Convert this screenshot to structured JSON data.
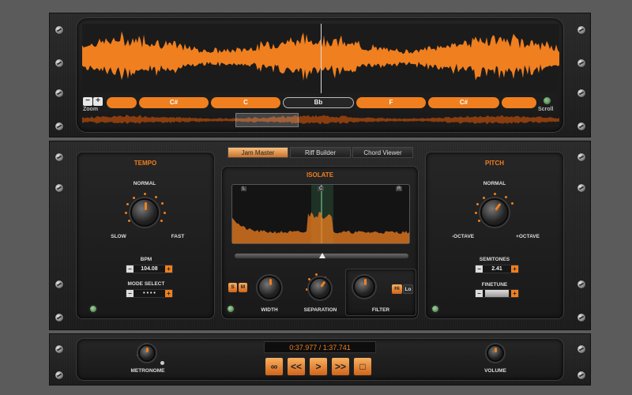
{
  "waveform": {
    "zoom_label": "Zoom",
    "scroll_label": "Scroll",
    "zoom_minus": "−",
    "zoom_plus": "+"
  },
  "chords": [
    "",
    "C#",
    "C",
    "Bb",
    "F",
    "C#",
    ""
  ],
  "tabs": [
    "Jam Master",
    "Riff Builder",
    "Chord Viewer"
  ],
  "tempo": {
    "title": "TEMPO",
    "normal": "NORMAL",
    "slow": "SLOW",
    "fast": "FAST",
    "bpm_label": "BPM",
    "bpm_value": "104.08",
    "mode_label": "MODE SELECT",
    "mode_value": "• • • •"
  },
  "isolate": {
    "title": "ISOLATE",
    "tag_l": "L",
    "tag_c": "C",
    "tag_r": "R",
    "s": "S",
    "m": "M",
    "width": "WIDTH",
    "separation": "SEPARATION",
    "filter": "FILTER",
    "hi": "Hi",
    "lo": "Lo"
  },
  "pitch": {
    "title": "PITCH",
    "normal": "NORMAL",
    "minus_octave": "-OCTAVE",
    "plus_octave": "+OCTAVE",
    "semitones_label": "SEMITONES",
    "semitones_value": "2.41",
    "finetune_label": "FINETUNE"
  },
  "transport": {
    "time": "0:37.977 / 1:37.741",
    "metronome": "METRONOME",
    "volume": "VOLUME",
    "loop": "∞",
    "rewind": "<<",
    "play": ">",
    "forward": ">>",
    "stop": "□"
  },
  "colors": {
    "accent": "#f07f1f",
    "background": "#5b5b5b",
    "panel": "#1e1e1e"
  }
}
